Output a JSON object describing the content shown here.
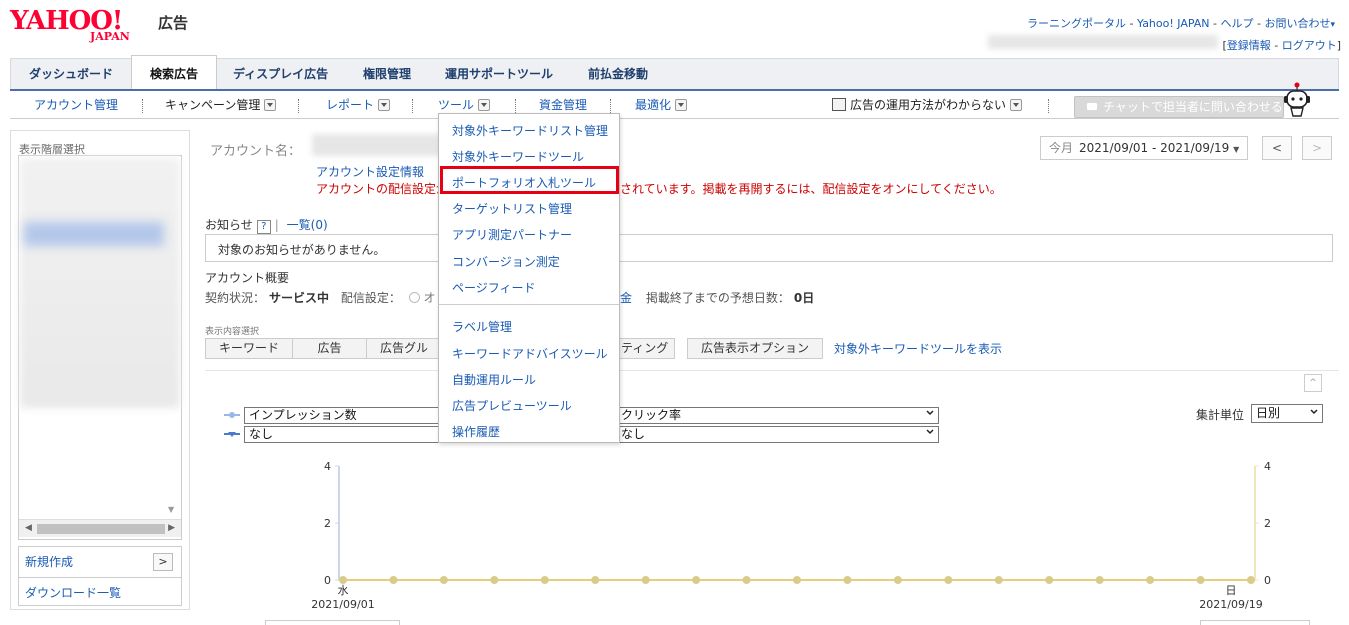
{
  "header": {
    "logo_yahoo": "YAHOO!",
    "logo_japan": "JAPAN",
    "logo_kokoku": "広告",
    "top_links": [
      "ラーニングポータル",
      "Yahoo! JAPAN",
      "ヘルプ",
      "お問い合わせ"
    ],
    "sep": " - ",
    "account_links": [
      "登録情報",
      "ログアウト"
    ],
    "bracket_close": "]"
  },
  "main_tabs": [
    "ダッシュボード",
    "検索広告",
    "ディスプレイ広告",
    "権限管理",
    "運用サポートツール",
    "前払金移動"
  ],
  "sub_nav": {
    "items": [
      "アカウント管理",
      "キャンペーン管理",
      "レポート",
      "ツール",
      "資金管理",
      "最適化"
    ],
    "help": "広告の運用方法がわからない",
    "chat": "チャットで担当者に問い合わせる"
  },
  "left_panel": {
    "title": "表示階層選択",
    "new": "新規作成",
    "new_arrow": ">",
    "download": "ダウンロード一覧"
  },
  "account": {
    "label": "アカウント名：",
    "settings_link": "アカウント設定情報",
    "warning_start": "アカウントの配信設定が",
    "warning_end": "されています。掲載を再開するには、配信設定をオンにしてください。"
  },
  "date": {
    "label": "今月",
    "range": "2021/09/01 - 2021/09/19",
    "prev": "<",
    "next": ">"
  },
  "notice": {
    "title": "お知らせ",
    "help": "?",
    "list_link": "一覧(0)",
    "message": "対象のお知らせがありません。"
  },
  "summary": {
    "title": "アカウント概要",
    "contract_key": "契約状況：",
    "contract_val": "サービス中",
    "delivery_key": "配信設定：",
    "delivery_val": "オ",
    "money_tail": "金",
    "days_key": "掲載終了までの予想日数：",
    "days_val": "0日"
  },
  "display": {
    "select_label": "表示内容選択",
    "tabs": [
      "キーワード",
      "広告",
      "広告グル",
      "ティング",
      "広告表示オプション"
    ],
    "kw_tool_link": "対象外キーワードツールを表示",
    "up_icon": "^"
  },
  "tool_menu": {
    "items": [
      "対象外キーワードリスト管理",
      "対象外キーワードツール",
      "ポートフォリオ入札ツール",
      "ターゲットリスト管理",
      "アプリ測定パートナー",
      "コンバージョン測定",
      "ページフィード",
      "ラベル管理",
      "キーワードアドバイスツール",
      "自動運用ルール",
      "広告プレビューツール",
      "操作履歴"
    ],
    "highlighted_index": 2
  },
  "chart_controls": {
    "metric1_left": "インプレッション数",
    "metric1_right": "クリック率",
    "metric2_left": "なし",
    "metric2_right": "なし",
    "aggregate_label": "集計単位",
    "aggregate_value": "日別"
  },
  "chart_data": {
    "type": "line",
    "x_start_label": "水",
    "x_start_date": "2021/09/01",
    "x_end_label": "日",
    "x_end_date": "2021/09/19",
    "yticks_left": [
      "4",
      "2",
      "0"
    ],
    "yticks_right": [
      "4",
      "2",
      "0"
    ],
    "ylim": [
      0,
      4
    ],
    "series": [
      {
        "values": [
          0,
          0,
          0,
          0,
          0,
          0,
          0,
          0,
          0,
          0,
          0,
          0,
          0,
          0,
          0,
          0,
          0,
          0,
          0
        ]
      }
    ],
    "colors": {
      "series": "#e6cf7a",
      "marker": "#d9cc8a",
      "axis_left": "#c9d6ee",
      "axis_right": "#f0e6bd"
    }
  }
}
